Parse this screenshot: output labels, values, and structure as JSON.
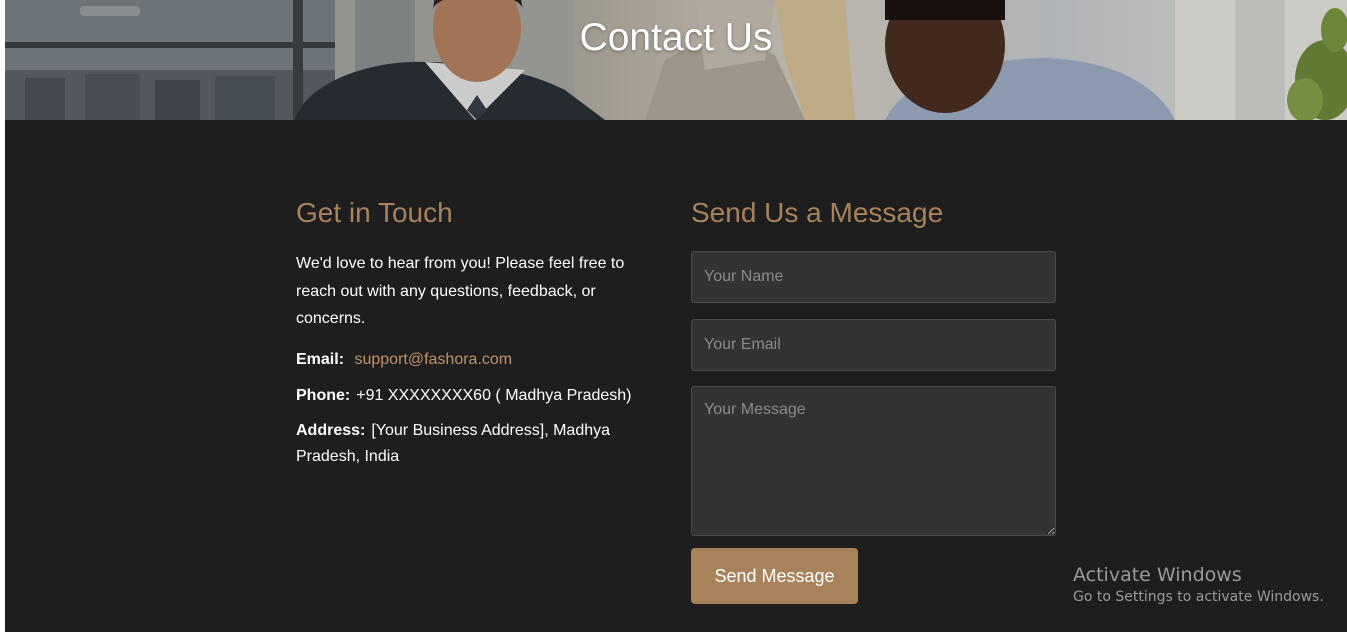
{
  "hero": {
    "title": "Contact Us"
  },
  "contact_info": {
    "heading": "Get in Touch",
    "intro": "We'd love to hear from you! Please feel free to reach out with any questions, feedback, or concerns.",
    "email_label": "Email:",
    "email_value": "support@fashora.com",
    "phone_label": "Phone:",
    "phone_value": "+91 XXXXXXXX60 ( Madhya Pradesh)",
    "address_label": "Address:",
    "address_value": "[Your Business Address], Madhya Pradesh, India"
  },
  "form": {
    "heading": "Send Us a Message",
    "name_placeholder": "Your Name",
    "email_placeholder": "Your Email",
    "message_placeholder": "Your Message",
    "submit_label": "Send Message"
  },
  "watermark": {
    "title": "Activate Windows",
    "subtitle": "Go to Settings to activate Windows."
  },
  "colors": {
    "background": "#1e1e1e",
    "accent": "#a8825a",
    "link": "#c09266",
    "field_background": "#333333"
  }
}
